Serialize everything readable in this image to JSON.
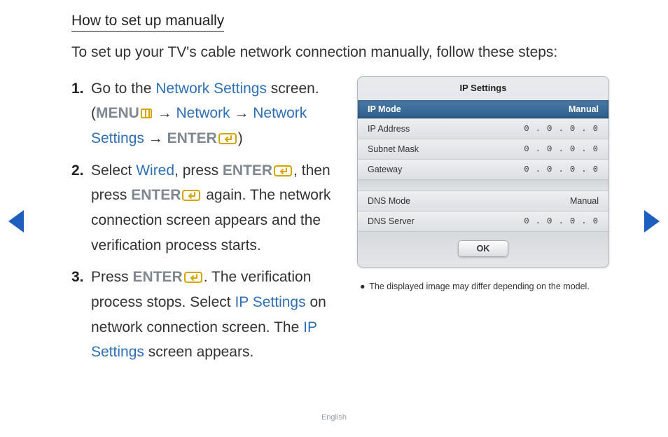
{
  "heading": "How to set up manually",
  "intro": "To set up your TV's cable network connection manually, follow these steps:",
  "steps": {
    "s1": {
      "num": "1.",
      "t1": "Go to the ",
      "link1": "Network Settings",
      "t2": " screen. (",
      "menu": "MENU",
      "arrow": " → ",
      "link2": "Network",
      "link3": "Network Settings",
      "enter": "ENTER",
      "close": ")"
    },
    "s2": {
      "num": "2.",
      "t1": "Select ",
      "link1": "Wired",
      "t2": ", press ",
      "enter": "ENTER",
      "t3": ", then press ",
      "t4": " again. The network connection screen appears and the verification process starts."
    },
    "s3": {
      "num": "3.",
      "t1": "Press ",
      "enter": "ENTER",
      "t2": ". The verification process stops. Select ",
      "link1": "IP Settings",
      "t3": " on network connection screen. The ",
      "link2": "IP Settings",
      "t4": " screen appears."
    }
  },
  "ip_panel": {
    "title": "IP Settings",
    "active": {
      "label": "IP Mode",
      "value": "Manual"
    },
    "rows": [
      {
        "label": "IP Address",
        "value": "0 . 0 . 0 . 0"
      },
      {
        "label": "Subnet Mask",
        "value": "0 . 0 . 0 . 0"
      },
      {
        "label": "Gateway",
        "value": "0 . 0 . 0 . 0"
      }
    ],
    "dns_mode": {
      "label": "DNS Mode",
      "value": "Manual"
    },
    "dns_server": {
      "label": "DNS Server",
      "value": "0 . 0 . 0 . 0"
    },
    "ok": "OK"
  },
  "disclaimer": "The displayed image may differ depending on the model.",
  "footer": "English"
}
